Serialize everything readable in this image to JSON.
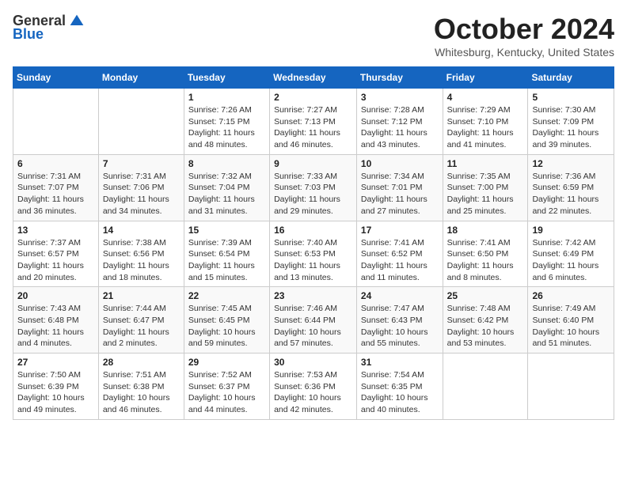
{
  "header": {
    "logo_general": "General",
    "logo_blue": "Blue",
    "month_title": "October 2024",
    "location": "Whitesburg, Kentucky, United States"
  },
  "days_of_week": [
    "Sunday",
    "Monday",
    "Tuesday",
    "Wednesday",
    "Thursday",
    "Friday",
    "Saturday"
  ],
  "weeks": [
    [
      {
        "day": "",
        "info": ""
      },
      {
        "day": "",
        "info": ""
      },
      {
        "day": "1",
        "info": "Sunrise: 7:26 AM\nSunset: 7:15 PM\nDaylight: 11 hours and 48 minutes."
      },
      {
        "day": "2",
        "info": "Sunrise: 7:27 AM\nSunset: 7:13 PM\nDaylight: 11 hours and 46 minutes."
      },
      {
        "day": "3",
        "info": "Sunrise: 7:28 AM\nSunset: 7:12 PM\nDaylight: 11 hours and 43 minutes."
      },
      {
        "day": "4",
        "info": "Sunrise: 7:29 AM\nSunset: 7:10 PM\nDaylight: 11 hours and 41 minutes."
      },
      {
        "day": "5",
        "info": "Sunrise: 7:30 AM\nSunset: 7:09 PM\nDaylight: 11 hours and 39 minutes."
      }
    ],
    [
      {
        "day": "6",
        "info": "Sunrise: 7:31 AM\nSunset: 7:07 PM\nDaylight: 11 hours and 36 minutes."
      },
      {
        "day": "7",
        "info": "Sunrise: 7:31 AM\nSunset: 7:06 PM\nDaylight: 11 hours and 34 minutes."
      },
      {
        "day": "8",
        "info": "Sunrise: 7:32 AM\nSunset: 7:04 PM\nDaylight: 11 hours and 31 minutes."
      },
      {
        "day": "9",
        "info": "Sunrise: 7:33 AM\nSunset: 7:03 PM\nDaylight: 11 hours and 29 minutes."
      },
      {
        "day": "10",
        "info": "Sunrise: 7:34 AM\nSunset: 7:01 PM\nDaylight: 11 hours and 27 minutes."
      },
      {
        "day": "11",
        "info": "Sunrise: 7:35 AM\nSunset: 7:00 PM\nDaylight: 11 hours and 25 minutes."
      },
      {
        "day": "12",
        "info": "Sunrise: 7:36 AM\nSunset: 6:59 PM\nDaylight: 11 hours and 22 minutes."
      }
    ],
    [
      {
        "day": "13",
        "info": "Sunrise: 7:37 AM\nSunset: 6:57 PM\nDaylight: 11 hours and 20 minutes."
      },
      {
        "day": "14",
        "info": "Sunrise: 7:38 AM\nSunset: 6:56 PM\nDaylight: 11 hours and 18 minutes."
      },
      {
        "day": "15",
        "info": "Sunrise: 7:39 AM\nSunset: 6:54 PM\nDaylight: 11 hours and 15 minutes."
      },
      {
        "day": "16",
        "info": "Sunrise: 7:40 AM\nSunset: 6:53 PM\nDaylight: 11 hours and 13 minutes."
      },
      {
        "day": "17",
        "info": "Sunrise: 7:41 AM\nSunset: 6:52 PM\nDaylight: 11 hours and 11 minutes."
      },
      {
        "day": "18",
        "info": "Sunrise: 7:41 AM\nSunset: 6:50 PM\nDaylight: 11 hours and 8 minutes."
      },
      {
        "day": "19",
        "info": "Sunrise: 7:42 AM\nSunset: 6:49 PM\nDaylight: 11 hours and 6 minutes."
      }
    ],
    [
      {
        "day": "20",
        "info": "Sunrise: 7:43 AM\nSunset: 6:48 PM\nDaylight: 11 hours and 4 minutes."
      },
      {
        "day": "21",
        "info": "Sunrise: 7:44 AM\nSunset: 6:47 PM\nDaylight: 11 hours and 2 minutes."
      },
      {
        "day": "22",
        "info": "Sunrise: 7:45 AM\nSunset: 6:45 PM\nDaylight: 10 hours and 59 minutes."
      },
      {
        "day": "23",
        "info": "Sunrise: 7:46 AM\nSunset: 6:44 PM\nDaylight: 10 hours and 57 minutes."
      },
      {
        "day": "24",
        "info": "Sunrise: 7:47 AM\nSunset: 6:43 PM\nDaylight: 10 hours and 55 minutes."
      },
      {
        "day": "25",
        "info": "Sunrise: 7:48 AM\nSunset: 6:42 PM\nDaylight: 10 hours and 53 minutes."
      },
      {
        "day": "26",
        "info": "Sunrise: 7:49 AM\nSunset: 6:40 PM\nDaylight: 10 hours and 51 minutes."
      }
    ],
    [
      {
        "day": "27",
        "info": "Sunrise: 7:50 AM\nSunset: 6:39 PM\nDaylight: 10 hours and 49 minutes."
      },
      {
        "day": "28",
        "info": "Sunrise: 7:51 AM\nSunset: 6:38 PM\nDaylight: 10 hours and 46 minutes."
      },
      {
        "day": "29",
        "info": "Sunrise: 7:52 AM\nSunset: 6:37 PM\nDaylight: 10 hours and 44 minutes."
      },
      {
        "day": "30",
        "info": "Sunrise: 7:53 AM\nSunset: 6:36 PM\nDaylight: 10 hours and 42 minutes."
      },
      {
        "day": "31",
        "info": "Sunrise: 7:54 AM\nSunset: 6:35 PM\nDaylight: 10 hours and 40 minutes."
      },
      {
        "day": "",
        "info": ""
      },
      {
        "day": "",
        "info": ""
      }
    ]
  ]
}
